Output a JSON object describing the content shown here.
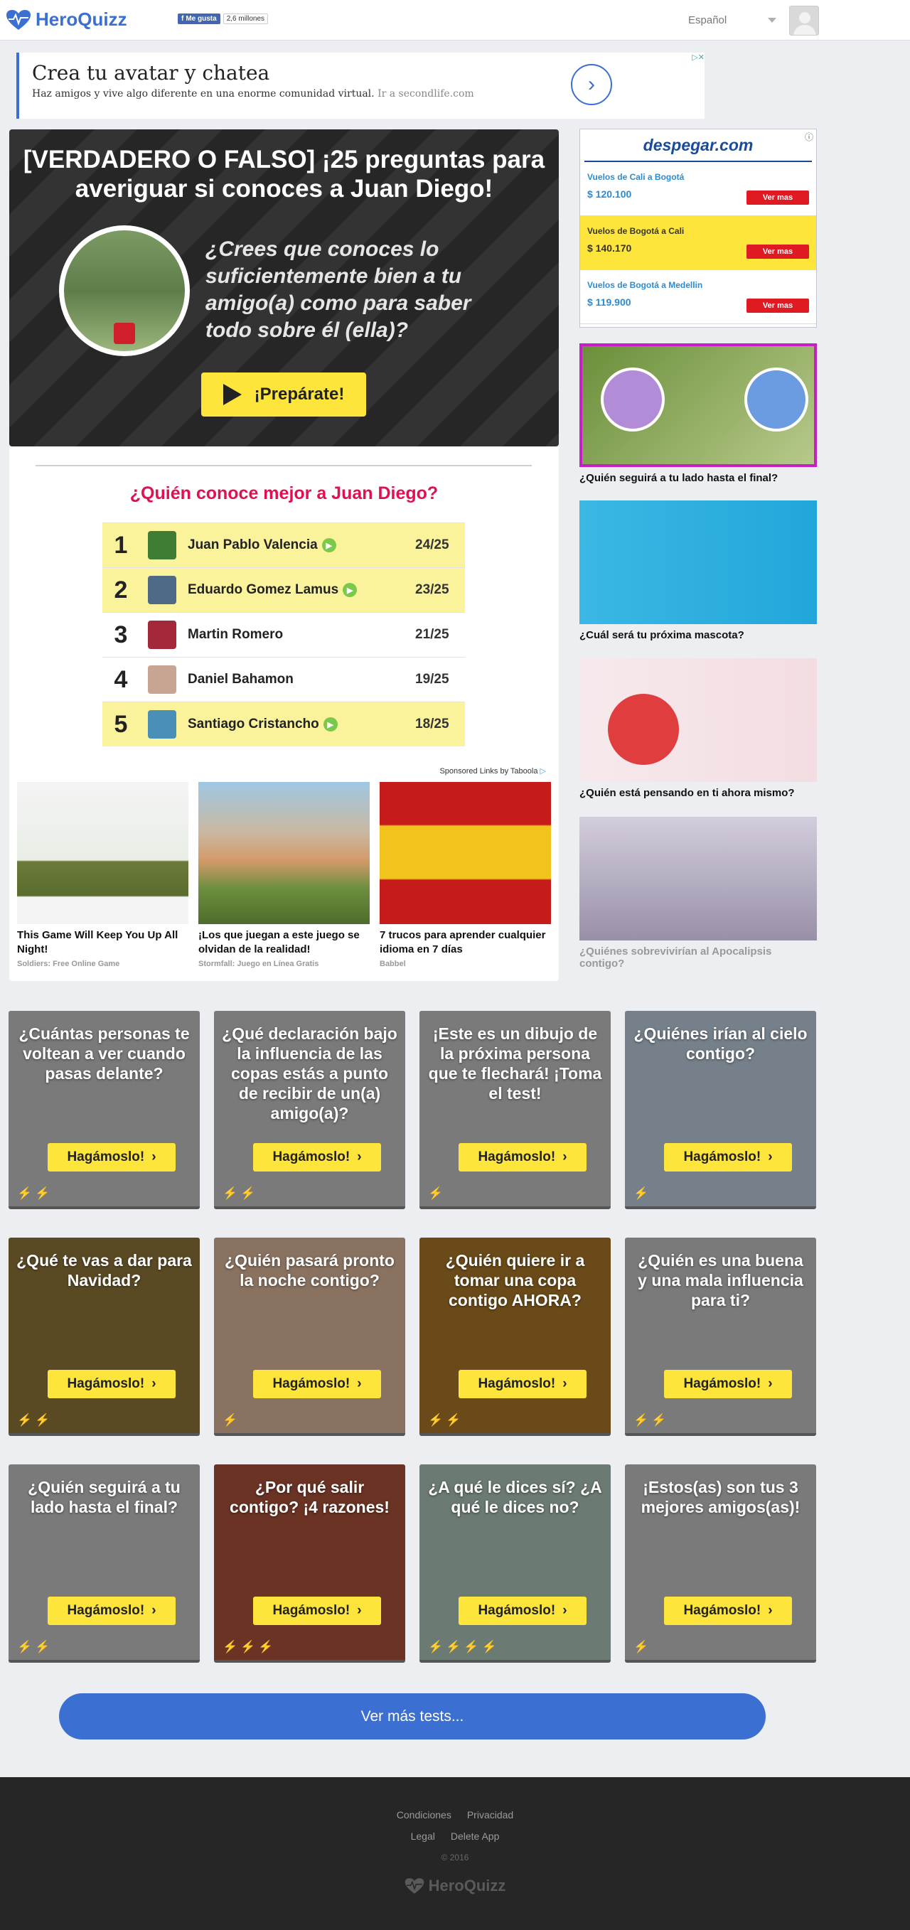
{
  "header": {
    "logo_text": "HeroQuizz",
    "fb_like_label": "Me gusta",
    "fb_like_count": "2,6 millones",
    "language": "Español"
  },
  "top_ad": {
    "title": "Crea tu avatar y chatea",
    "body": "Haz amigos y vive algo diferente en una enorme comunidad virtual.",
    "source": "Ir a secondlife.com"
  },
  "hero": {
    "title": "[VERDADERO O FALSO] ¡25 preguntas para averiguar si conoces a Juan Diego!",
    "tagline": "¿Crees que conoces lo suficientemente bien a tu amigo(a) como para saber todo sobre él (ella)?",
    "cta": "¡Prepárate!"
  },
  "leaderboard": {
    "title": "¿Quién conoce mejor a Juan Diego?",
    "rows": [
      {
        "rank": "1",
        "name": "Juan Pablo Valencia",
        "score": "24/25",
        "verified": true,
        "highlight": true,
        "color": "#3f7d34"
      },
      {
        "rank": "2",
        "name": "Eduardo Gomez Lamus",
        "score": "23/25",
        "verified": true,
        "highlight": true,
        "color": "#4d6b86"
      },
      {
        "rank": "3",
        "name": "Martin Romero",
        "score": "21/25",
        "verified": false,
        "highlight": false,
        "color": "#a3283a"
      },
      {
        "rank": "4",
        "name": "Daniel Bahamon",
        "score": "19/25",
        "verified": false,
        "highlight": false,
        "color": "#c8a592"
      },
      {
        "rank": "5",
        "name": "Santiago Cristancho",
        "score": "18/25",
        "verified": true,
        "highlight": true,
        "color": "#4a8fb8"
      }
    ]
  },
  "sponsored": {
    "label": "Sponsored Links by Taboola",
    "items": [
      {
        "title": "This Game Will Keep You Up All Night!",
        "source": "Soldiers: Free Online Game"
      },
      {
        "title": "¡Los que juegan a este juego se olvidan de la realidad!",
        "source": "Stormfall: Juego en Línea Gratis"
      },
      {
        "title": "7 trucos para aprender cualquier idioma en 7 días",
        "source": "Babbel"
      }
    ]
  },
  "despegar": {
    "brand": "despegar.com",
    "deals": [
      {
        "route": "Vuelos de Cali a Bogotá",
        "price": "$ 120.100",
        "button": "Ver mas"
      },
      {
        "route": "Vuelos de Bogotá a Cali",
        "price": "$ 140.170",
        "button": "Ver mas"
      },
      {
        "route": "Vuelos de Bogotá a Medellin",
        "price": "$ 119.900",
        "button": "Ver mas"
      }
    ]
  },
  "sidebar_quizzes": [
    {
      "caption": "¿Quién seguirá a tu lado hasta el final?"
    },
    {
      "caption": "¿Cuál será tu próxima mascota?"
    },
    {
      "caption": "¿Quién está pensando en ti ahora mismo?"
    },
    {
      "caption": "¿Quiénes sobrevivirían al Apocalipsis contigo?"
    }
  ],
  "quiz_grid": {
    "button_label": "Hagámoslo!",
    "cards": [
      {
        "title": "¿Cuántas personas te voltean a ver cuando pasas delante?",
        "bolts": "2",
        "bg": "#7a7a7a"
      },
      {
        "title": "¿Qué declaración bajo la influencia de las copas estás a punto de recibir de un(a) amigo(a)?",
        "bolts": "2",
        "bg": "#7a7a7a"
      },
      {
        "title": "¡Este es un dibujo de la próxima persona que te flechará! ¡Toma el test!",
        "bolts": "1",
        "bg": "#7a7a7a"
      },
      {
        "title": "¿Quiénes irían al cielo contigo?",
        "bolts": "1",
        "bg": "#76808a"
      },
      {
        "title": "¿Qué te vas a dar para Navidad?",
        "bolts": "2",
        "bg": "#5a4a24"
      },
      {
        "title": "¿Quién pasará pronto la noche contigo?",
        "bolts": "1",
        "bg": "#8a7260"
      },
      {
        "title": "¿Quién quiere ir a tomar una copa contigo AHORA?",
        "bolts": "2",
        "bg": "#6a4a18"
      },
      {
        "title": "¿Quién es una buena y una mala influencia para ti?",
        "bolts": "2",
        "bg": "#7a7a7a"
      },
      {
        "title": "¿Quién seguirá a tu lado hasta el final?",
        "bolts": "2",
        "bg": "#7a7a7a"
      },
      {
        "title": "¿Por qué salir contigo? ¡4 razones!",
        "bolts": "3",
        "bg": "#6a3324",
        "gold": true
      },
      {
        "title": "¿A qué le dices sí? ¿A qué le dices no?",
        "bolts": "4",
        "bg": "#6b7a72",
        "gold": true
      },
      {
        "title": "¡Estos(as) son tus 3 mejores amigos(as)!",
        "bolts": "1",
        "bg": "#7a7a7a"
      }
    ]
  },
  "more_button": "Ver más tests...",
  "footer": {
    "links_row1": [
      "Condiciones",
      "Privacidad"
    ],
    "links_row2": [
      "Legal",
      "Delete App"
    ],
    "copyright": "© 2016",
    "logo_text": "HeroQuizz"
  }
}
